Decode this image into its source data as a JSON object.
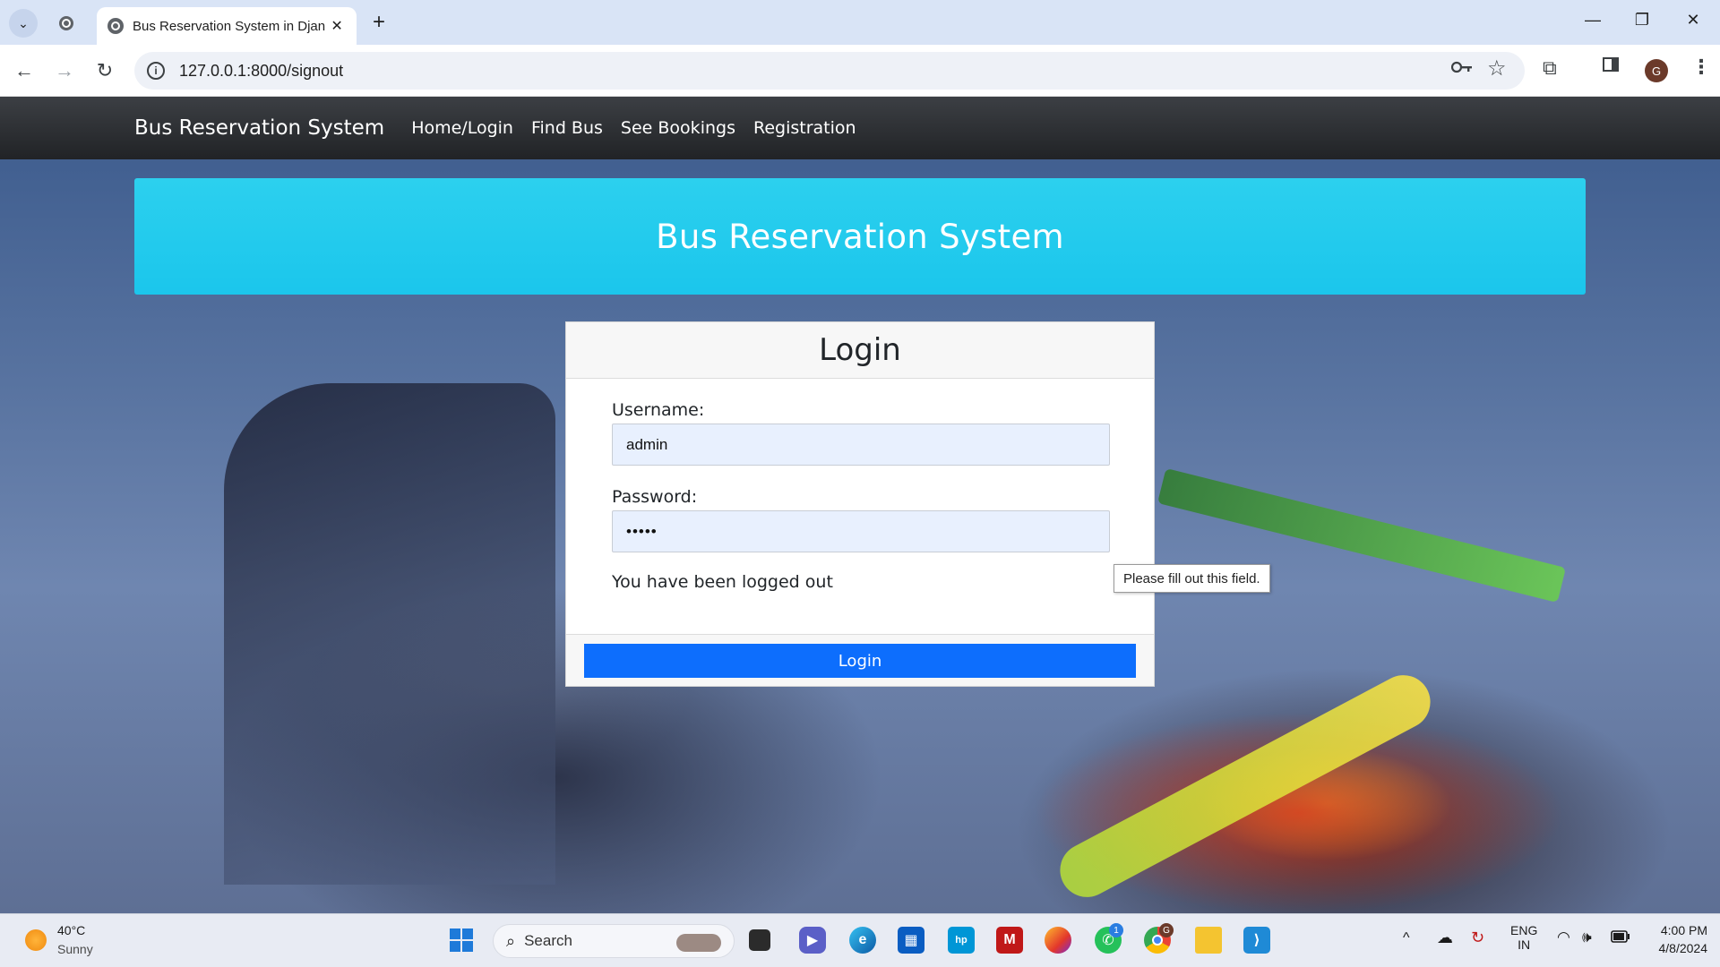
{
  "browser": {
    "tab_title": "Bus Reservation System in Djan",
    "url": "127.0.0.1:8000/signout",
    "profile_initial": "G",
    "new_tab": "+",
    "tab_close": "✕"
  },
  "navbar": {
    "brand": "Bus Reservation System",
    "links": [
      "Home/Login",
      "Find Bus",
      "See Bookings",
      "Registration"
    ]
  },
  "jumbotron": {
    "title": "Bus Reservation System"
  },
  "login": {
    "heading": "Login",
    "username_label": "Username:",
    "username_value": "admin",
    "password_label": "Password:",
    "password_value": "•••••",
    "message": "You have been logged out",
    "button": "Login",
    "tooltip": "Please fill out this field."
  },
  "taskbar": {
    "temperature": "40°C",
    "condition": "Sunny",
    "search_placeholder": "Search",
    "language_top": "ENG",
    "language_bottom": "IN",
    "time": "4:00 PM",
    "date": "4/8/2024",
    "whatsapp_badge": "1",
    "chrome_badge": "G"
  },
  "colors": {
    "navbar_bg": "#212326",
    "jumbotron_bg": "#1bc6ec",
    "login_button": "#0d6efd",
    "input_bg": "#e8f0fe"
  },
  "icons": [
    "tab-search-icon",
    "site-globe-icon",
    "back-icon",
    "forward-icon",
    "reload-icon",
    "info-icon",
    "key-icon",
    "star-icon",
    "extensions-icon",
    "sidepanel-icon",
    "menu-icon",
    "windows-start-icon",
    "search-icon",
    "task-view-icon",
    "teams-icon",
    "edge-icon",
    "store-icon",
    "myhp-icon",
    "mcafee-icon",
    "firefox-icon",
    "whatsapp-icon",
    "chrome-icon",
    "file-explorer-icon",
    "vscode-icon",
    "wifi-icon",
    "volume-icon",
    "battery-icon"
  ]
}
